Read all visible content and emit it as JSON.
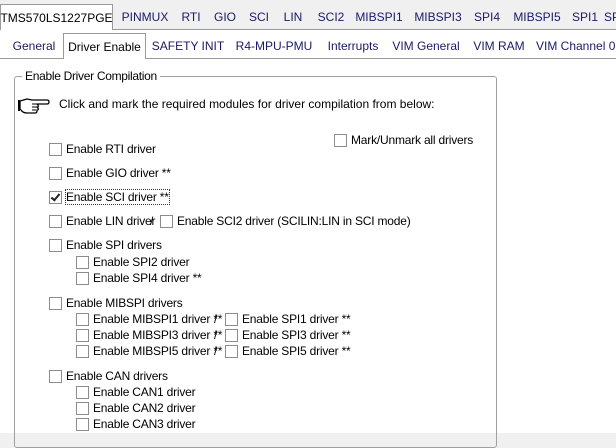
{
  "tabs_top": [
    "TMS570LS1227PGE",
    "PINMUX",
    "RTI",
    "GIO",
    "SCI",
    "LIN",
    "SCI2",
    "MIBSPI1",
    "MIBSPI3",
    "SPI4",
    "MIBSPI5",
    "SPI1",
    "SPI"
  ],
  "tabs_sub": [
    "General",
    "Driver Enable",
    "SAFETY INIT",
    "R4-MPU-PMU",
    "Interrupts",
    "VIM General",
    "VIM RAM",
    "VIM Channel 0"
  ],
  "group_title": "Enable Driver Compilation",
  "instruction": "Click and mark the required modules for driver compilation from below:",
  "mark_all": "Mark/Unmark all drivers",
  "checks": {
    "rti": "Enable RTI driver",
    "gio": "Enable GIO driver **",
    "sci": "Enable SCI driver **",
    "lin": "Enable LIN driver",
    "sci2": "Enable SCI2 driver (SCILIN:LIN in SCI mode)",
    "spi": "Enable SPI drivers",
    "spi2": "Enable SPI2 driver",
    "spi4": "Enable SPI4 driver **",
    "mibspi": "Enable MIBSPI drivers",
    "mibspi1": "Enable MIBSPI1 driver **",
    "spi1": "Enable SPI1 driver **",
    "mibspi3": "Enable MIBSPI3 driver **",
    "spi3": "Enable SPI3 driver **",
    "mibspi5": "Enable MIBSPI5 driver **",
    "spi5": "Enable SPI5 driver **",
    "can": "Enable CAN drivers",
    "can1": "Enable CAN1 driver",
    "can2": "Enable CAN2 driver",
    "can3": "Enable CAN3 driver"
  },
  "checked": [
    "sci"
  ],
  "separator": "/",
  "icons": {
    "pointer": "pointing-hand-icon"
  }
}
